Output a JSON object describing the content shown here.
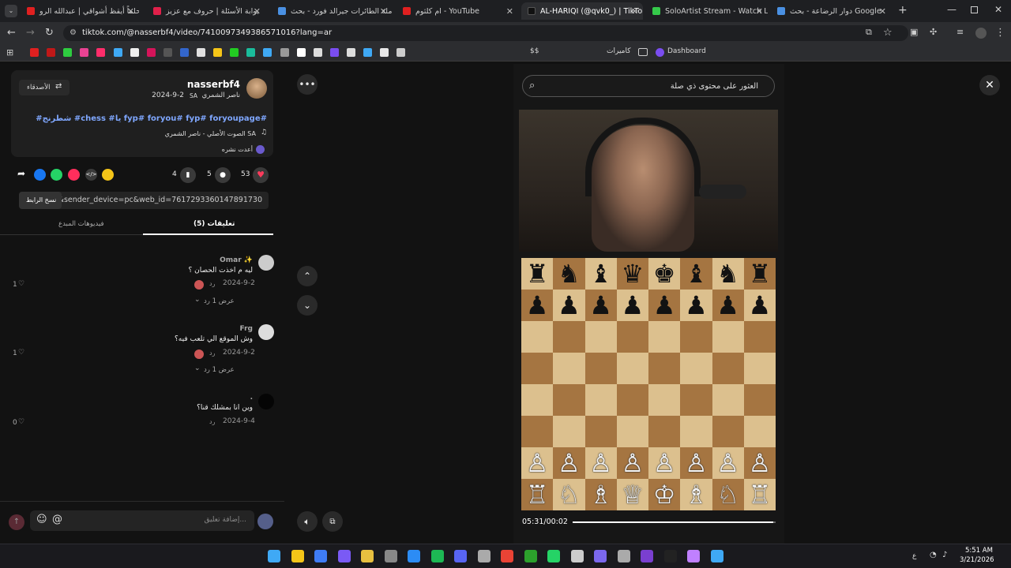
{
  "tabs": [
    {
      "title": "يا حلماً أيقظ أشواقي | عبدالله الرو",
      "color": "#e02020"
    },
    {
      "title": "بوابة الأسئلة | حروف مع عزيز",
      "color": "#e0204a"
    },
    {
      "title": "حاملة الطائرات جيرالد فورد - بحث",
      "color": "#4a90e2"
    },
    {
      "title": "ام كلثوم - YouTube",
      "color": "#e02020"
    },
    {
      "title": "AL-HARIQI (@qvk0_) | TikTok",
      "color": "#111111"
    },
    {
      "title": "SoloArtist Stream - Watch Live",
      "color": "#35c94a"
    },
    {
      "title": "دوار الرضاعة - بحث Google",
      "color": "#4a90e2"
    }
  ],
  "url": "tiktok.com/@nasserbf4/video/7410097349386571016?lang=ar",
  "bookmarks": {
    "folder_label": "كاميرات",
    "dashboard_label": "Dashboard",
    "ss_label": "$$"
  },
  "post": {
    "username": "nasserbf4",
    "display_name": "ناصر الشمري",
    "country": "SA",
    "date": "2024-9-2",
    "follow_label": "الأصدقاء",
    "hashtags": "#شطرنج #chess #يا fyp# foryou# fyp# foryoupage#",
    "sound": "الصوت الأصلي - ناصر الشمري SA",
    "reposted": "أعدت نشره",
    "likes": "53",
    "comments": "5",
    "saves": "4",
    "link": "...p=1&sender_device=pc&web_id=7617293360147891730",
    "copy_link_label": "نسخ الرابط"
  },
  "tabs_panel": {
    "comments_tab": "تعليقات (5)",
    "creator_tab": "فيديوهات المبدع"
  },
  "comments": [
    {
      "user": "Omar ✨",
      "text": "ليه م اخذت الحصان ؟",
      "date": "2024-9-2",
      "reply": "رد",
      "view_replies": "عرض 1 رد",
      "likes": "1"
    },
    {
      "user": "Frg",
      "text": "وش الموقع الي تلعب فيه؟",
      "date": "2024-9-2",
      "reply": "رد",
      "view_replies": "عرض 1 رد",
      "likes": "1"
    },
    {
      "user": ".",
      "text": "وين انا بمشلك قنا؟",
      "date": "2024-9-4",
      "reply": "رد",
      "view_replies": "",
      "likes": "0"
    }
  ],
  "comment_input": {
    "placeholder": "إضافة تعليق..."
  },
  "video": {
    "search_placeholder": "العثور على محتوى ذي صلة",
    "time": "05:31/00:02",
    "progress": 0.99
  },
  "board_rows": [
    [
      "♜",
      "♞",
      "♝",
      "♛",
      "♚",
      "♝",
      "♞",
      "♜"
    ],
    [
      "♟",
      "♟",
      "♟",
      "♟",
      "♟",
      "♟",
      "♟",
      "♟"
    ],
    [
      "",
      "",
      "",
      "",
      "",
      "",
      "",
      ""
    ],
    [
      "",
      "",
      "",
      "",
      "",
      "",
      "",
      ""
    ],
    [
      "",
      "",
      "",
      "",
      "",
      "",
      "",
      ""
    ],
    [
      "",
      "",
      "",
      "",
      "",
      "",
      "",
      ""
    ],
    [
      "♙",
      "♙",
      "♙",
      "♙",
      "♙",
      "♙",
      "♙",
      "♙"
    ],
    [
      "♖",
      "♘",
      "♗",
      "♕",
      "♔",
      "♗",
      "♘",
      "♖"
    ]
  ],
  "taskbar": {
    "time": "5:51 AM",
    "date": "3/21/2026",
    "lang": "ع"
  }
}
